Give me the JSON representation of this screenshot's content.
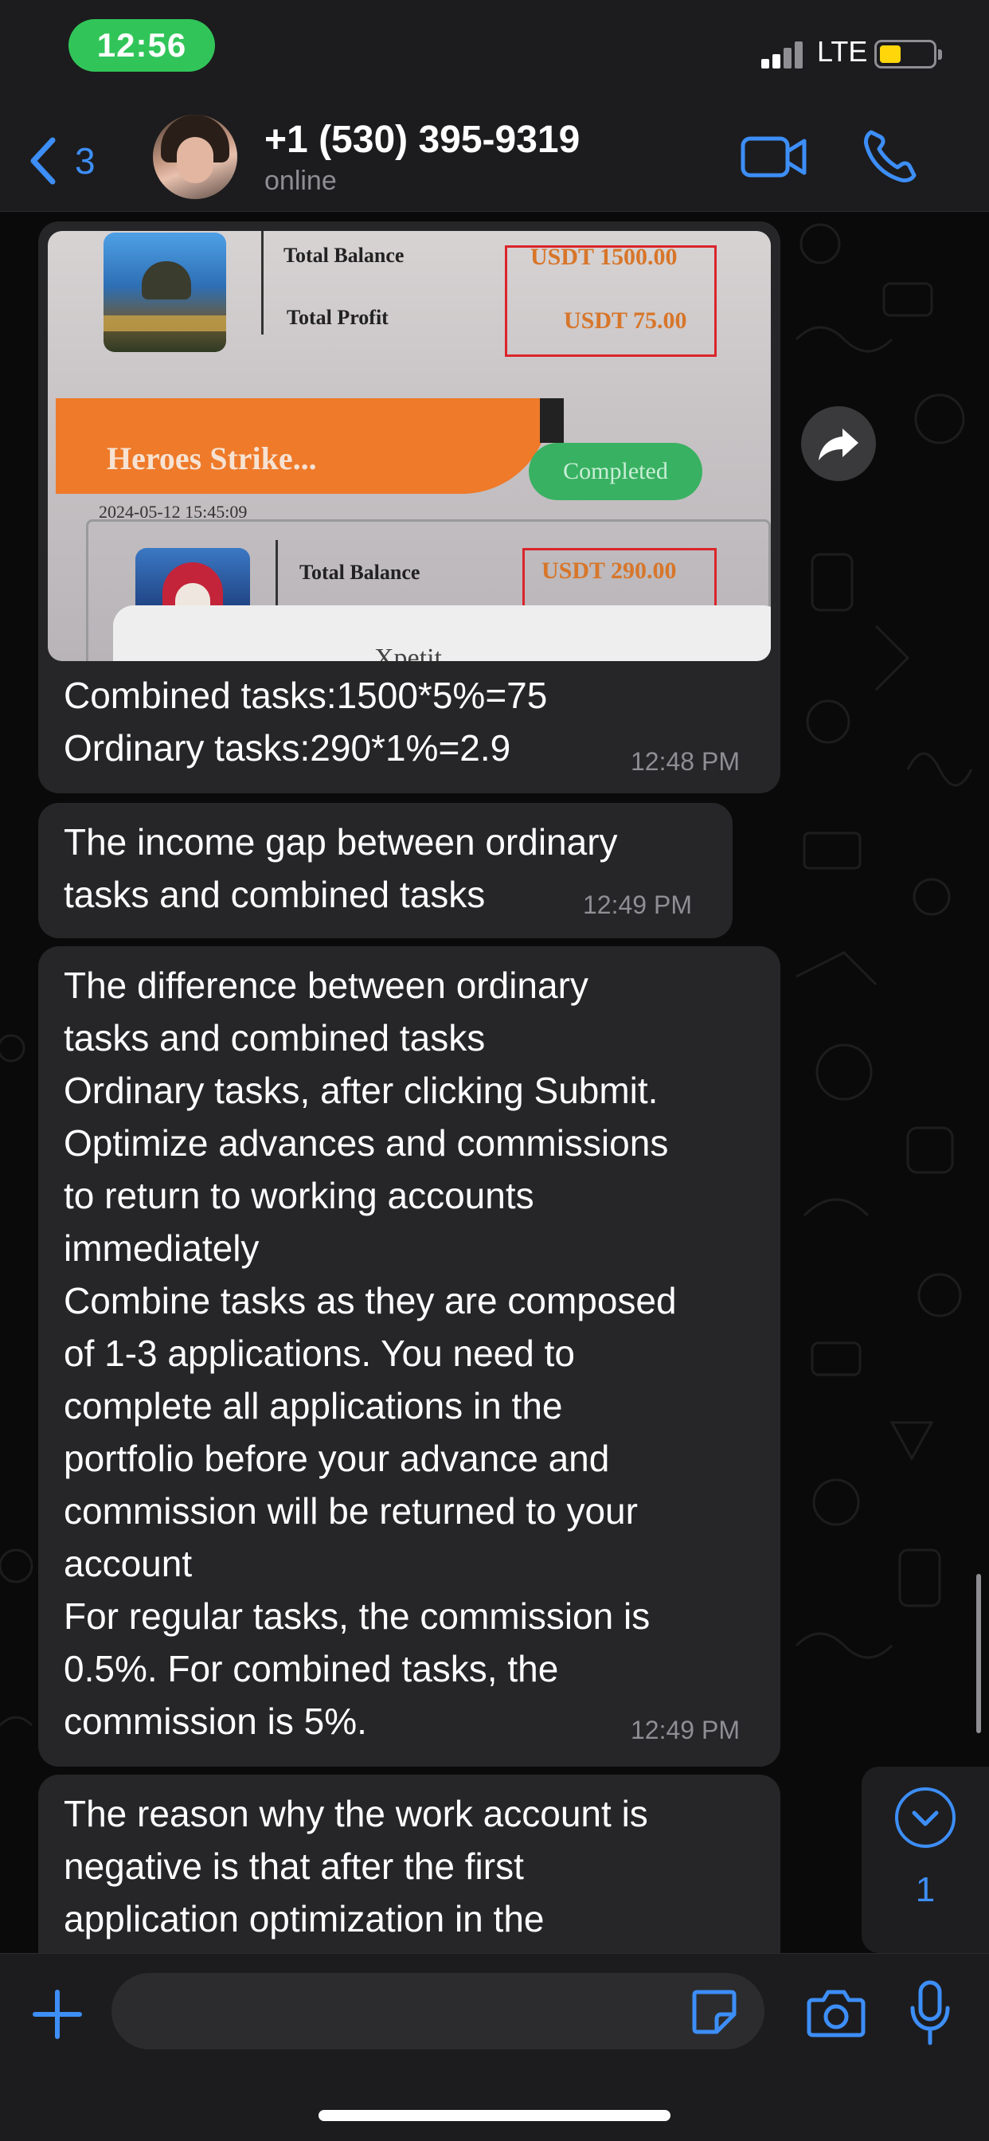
{
  "status_bar": {
    "time": "12:56",
    "network": "LTE"
  },
  "header": {
    "back_count": "3",
    "contact_name": "+1 (530) 395-9319",
    "contact_status": "online",
    "icons": {
      "back": "chevron-left-icon",
      "video": "video-camera-icon",
      "call": "phone-icon"
    }
  },
  "image_message": {
    "photo": {
      "label_total_balance": "Total Balance",
      "label_total_profit": "Total Profit",
      "balance_value_1": "USDT 1500.00",
      "profit_value_1": "USDT 75.00",
      "banner_title": "Heroes Strike...",
      "status": "Completed",
      "date": "2024-05-12 15:45:09",
      "label_total_balance_2": "Total Balance",
      "balance_value_2": "USDT 290.00",
      "popup_text": "Xpetit"
    },
    "caption": "Combined tasks:1500*5%=75\nOrdinary tasks:290*1%=2.9",
    "time": "12:48 PM"
  },
  "messages": [
    {
      "text": "The income gap between ordinary\ntasks and combined tasks",
      "time": "12:49 PM"
    },
    {
      "text": "The difference between ordinary\ntasks and combined tasks\nOrdinary tasks, after clicking Submit.\nOptimize advances and commissions\nto return to working accounts\nimmediately\nCombine tasks as they are composed\nof 1-3 applications. You need to\ncomplete all applications in the\nportfolio before your advance and\ncommission will be returned to your\naccount\nFor regular tasks, the commission is\n0.5%. For combined tasks, the\ncommission is 5%.",
      "time": "12:49 PM"
    },
    {
      "text": "The reason why the work account is\nnegative is that after the first\napplication optimization in the",
      "time": ""
    }
  ],
  "scroll_down": {
    "unread_count": "1"
  },
  "composer": {
    "placeholder": ""
  },
  "colors": {
    "accent": "#3d8ef7",
    "clock_pill": "#31c559",
    "bubble": "#262628",
    "background": "#0a0a0a"
  }
}
